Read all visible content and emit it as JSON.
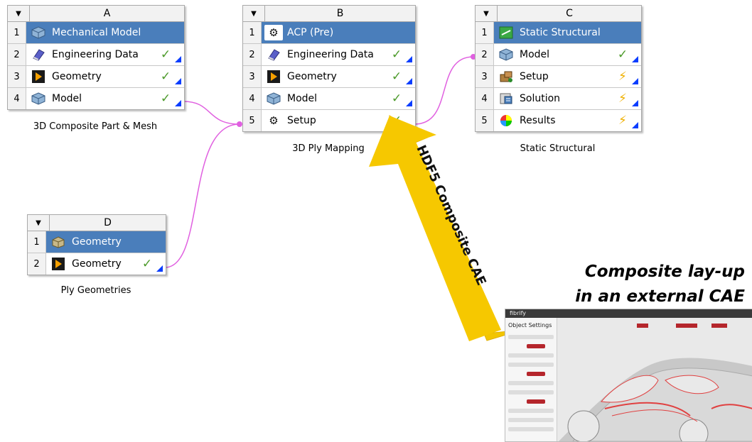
{
  "systems": {
    "A": {
      "letter": "A",
      "caption": "3D Composite Part & Mesh",
      "cells": [
        {
          "n": "1",
          "label": "Mechanical Model",
          "icon": "model-cube-icon",
          "status": ""
        },
        {
          "n": "2",
          "label": "Engineering Data",
          "icon": "book-icon",
          "status": "✓"
        },
        {
          "n": "3",
          "label": "Geometry",
          "icon": "geometry-icon",
          "status": "✓"
        },
        {
          "n": "4",
          "label": "Model",
          "icon": "model-cube-icon",
          "status": "✓"
        }
      ]
    },
    "B": {
      "letter": "B",
      "caption": "3D Ply Mapping",
      "cells": [
        {
          "n": "1",
          "label": "ACP (Pre)",
          "icon": "gears-icon",
          "status": ""
        },
        {
          "n": "2",
          "label": "Engineering Data",
          "icon": "book-icon",
          "status": "✓"
        },
        {
          "n": "3",
          "label": "Geometry",
          "icon": "geometry-icon",
          "status": "✓"
        },
        {
          "n": "4",
          "label": "Model",
          "icon": "model-cube-icon",
          "status": "✓"
        },
        {
          "n": "5",
          "label": "Setup",
          "icon": "gears-icon",
          "status": "✓"
        }
      ]
    },
    "C": {
      "letter": "C",
      "caption": "Static Structural",
      "cells": [
        {
          "n": "1",
          "label": "Static Structural",
          "icon": "static-structural-icon",
          "status": ""
        },
        {
          "n": "2",
          "label": "Model",
          "icon": "model-cube-icon",
          "status": "✓"
        },
        {
          "n": "3",
          "label": "Setup",
          "icon": "setup-icon",
          "status": "⚡"
        },
        {
          "n": "4",
          "label": "Solution",
          "icon": "solution-icon",
          "status": "⚡"
        },
        {
          "n": "5",
          "label": "Results",
          "icon": "results-icon",
          "status": "⚡"
        }
      ]
    },
    "D": {
      "letter": "D",
      "caption": "Ply Geometries",
      "cells": [
        {
          "n": "1",
          "label": "Geometry",
          "icon": "geometry-box-icon",
          "status": ""
        },
        {
          "n": "2",
          "label": "Geometry",
          "icon": "geometry-icon",
          "status": "✓"
        }
      ]
    }
  },
  "arrow_label": "HDF5 Composite CAE",
  "overlay_title": {
    "line1": "Composite lay-up",
    "line2": "in an external CAE"
  },
  "cae": {
    "brand": "fibrify",
    "panel_title": "Object Settings"
  },
  "colors": {
    "selected": "#4a7ebb",
    "check": "#4c9a2a",
    "lightning": "#f0b000",
    "link": "#e060e0",
    "arrow": "#f2c500",
    "ply": "#e04040"
  }
}
